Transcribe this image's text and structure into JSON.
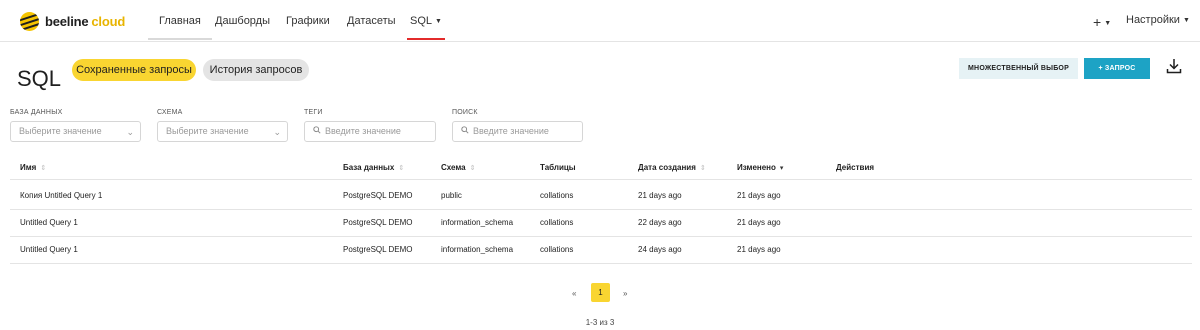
{
  "brand": {
    "name_part1": "beeline",
    "name_part2": "cloud",
    "accent": "#f5c400"
  },
  "nav": {
    "items": [
      {
        "label": "Главная"
      },
      {
        "label": "Дашборды"
      },
      {
        "label": "Графики"
      },
      {
        "label": "Датасеты"
      },
      {
        "label": "SQL"
      }
    ],
    "plus_label": "+",
    "settings_label": "Настройки"
  },
  "page": {
    "title": "SQL"
  },
  "tabs": {
    "saved": "Сохраненные запросы",
    "history": "История запросов"
  },
  "actions": {
    "multi_select": "МНОЖЕСТВЕННЫЙ ВЫБОР",
    "query": "+ ЗАПРОС",
    "query_color": "#1da3c5"
  },
  "filters": {
    "database": {
      "label": "БАЗА ДАННЫХ",
      "placeholder": "Выберите значение"
    },
    "schema": {
      "label": "СХЕМА",
      "placeholder": "Выберите значение"
    },
    "tags": {
      "label": "ТЕГИ",
      "placeholder": "Введите значение"
    },
    "search": {
      "label": "ПОИСК",
      "placeholder": "Введите значение"
    }
  },
  "table": {
    "columns": [
      "Имя",
      "База данных",
      "Схема",
      "Таблицы",
      "Дата создания",
      "Изменено",
      "Действия"
    ],
    "rows": [
      {
        "name": "Копия Untitled Query 1",
        "database": "PostgreSQL DEMO",
        "schema": "public",
        "tables": "collations",
        "created": "21 days ago",
        "modified": "21 days ago"
      },
      {
        "name": "Untitled Query 1",
        "database": "PostgreSQL DEMO",
        "schema": "information_schema",
        "tables": "collations",
        "created": "22 days ago",
        "modified": "21 days ago"
      },
      {
        "name": "Untitled Query 1",
        "database": "PostgreSQL DEMO",
        "schema": "information_schema",
        "tables": "collations",
        "created": "24 days ago",
        "modified": "21 days ago"
      }
    ]
  },
  "pagination": {
    "prev": "«",
    "current": "1",
    "next": "»",
    "info": "1-3 из 3"
  }
}
